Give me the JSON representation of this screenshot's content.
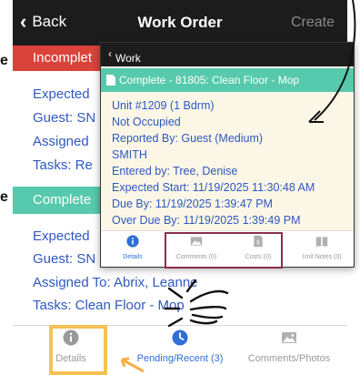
{
  "edge_letters": [
    "e",
    "e"
  ],
  "navbar": {
    "back_label": "Back",
    "title": "Work Order",
    "create_label": "Create"
  },
  "bg": {
    "status1": "Incomplet",
    "lines1": [
      "Expected",
      "Guest: SN",
      "Assigned",
      "Tasks: Re"
    ],
    "status2": "Complete",
    "lines2": [
      "Expected",
      "Guest: SN",
      "Assigned To: Abrix, Leanne",
      "Tasks: Clean Floor - Mop"
    ]
  },
  "tabbar": [
    {
      "label": "Details"
    },
    {
      "label": "Pending/Recent (3)"
    },
    {
      "label": "Comments/Photos"
    }
  ],
  "popup": {
    "back_label": "Work Order",
    "status_text": "Complete - 81805: Clean Floor - Mop",
    "lines": [
      "Unit #1209 (1 Bdrm)",
      "Not Occupied",
      "Reported By: Guest  (Medium)",
      "SMITH",
      "Entered by: Tree, Denise",
      "Expected Start: 11/19/2025 11:30:48 AM",
      "Due By: 11/19/2025 1:39:47 PM",
      "Over Due By: 11/19/2025 1:39:49 PM"
    ],
    "tabs": [
      {
        "label": "Details"
      },
      {
        "label": "Comments (0)"
      },
      {
        "label": "Costs (0)"
      },
      {
        "label": "Unit Notes (0)"
      }
    ]
  },
  "colors": {
    "nav": "#1c1c1c",
    "incomplete": "#d9433a",
    "complete": "#57c9ac",
    "link_blue": "#2f58c0",
    "highlight_box": "#8c2f49",
    "highlight_yellow": "#f5c054",
    "arrow_orange": "#f5b04a"
  }
}
